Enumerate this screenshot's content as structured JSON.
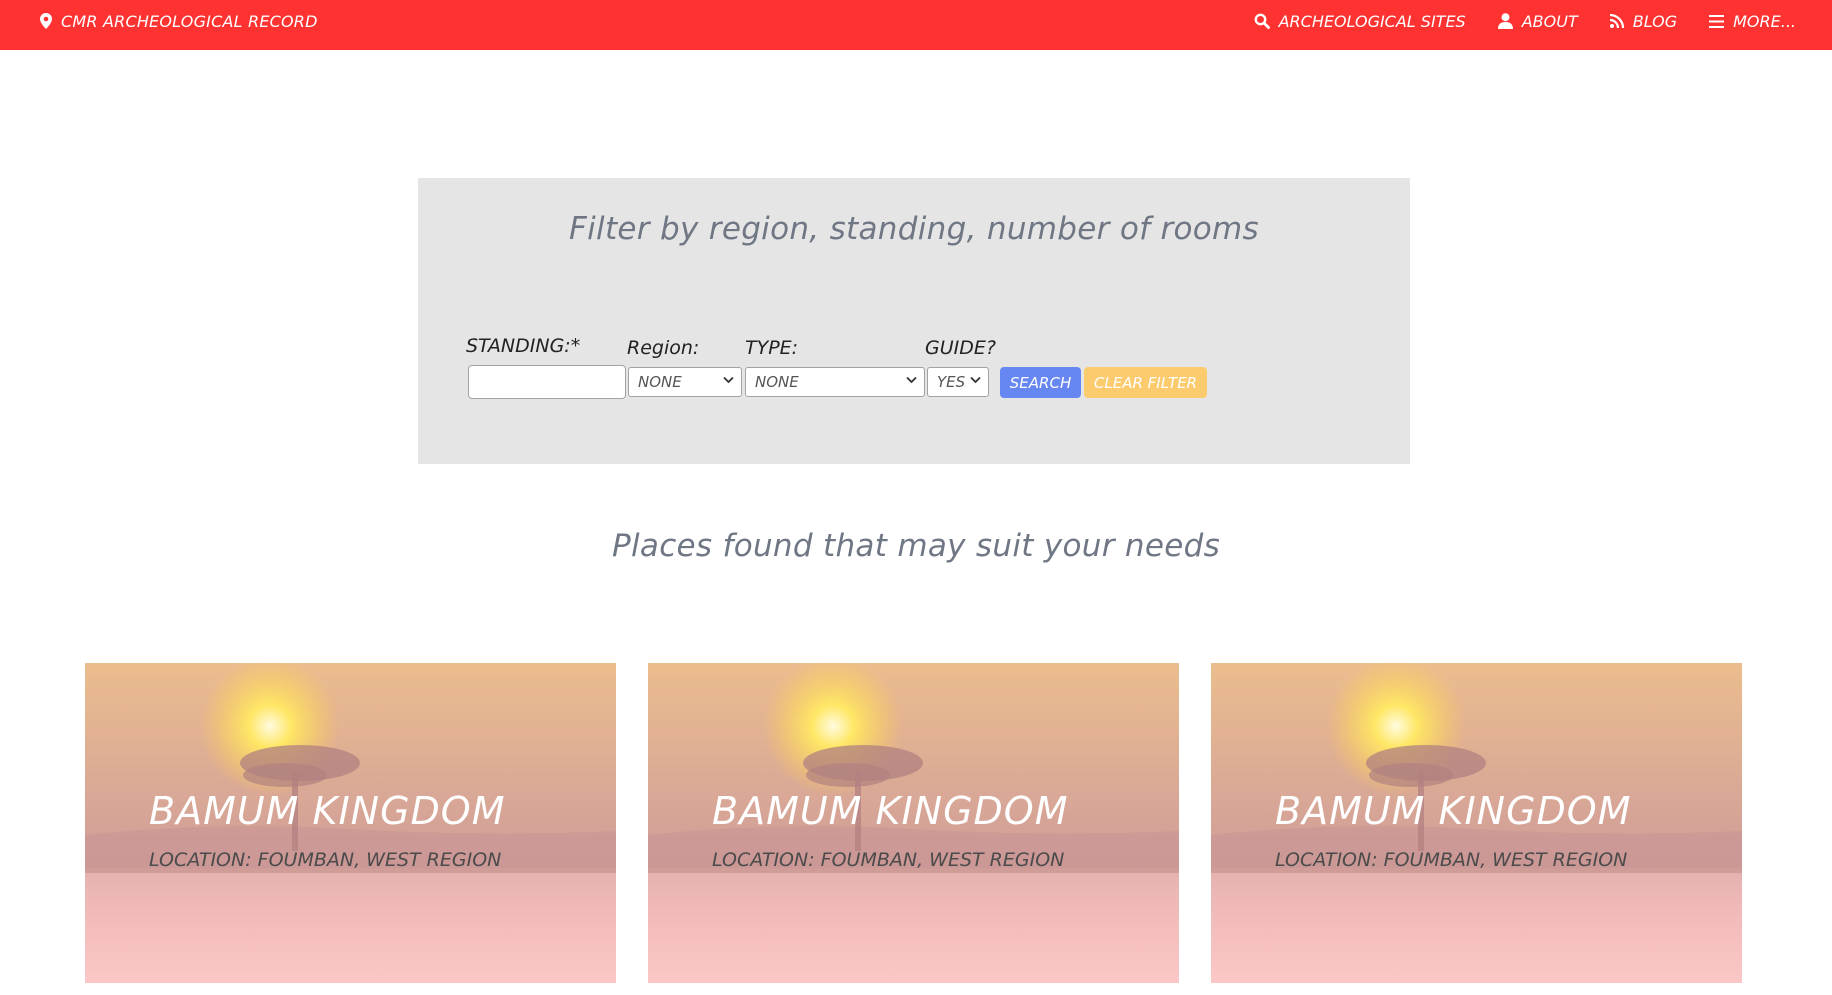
{
  "navbar": {
    "brand": "CMR ARCHEOLOGICAL RECORD",
    "brand_icon": "map-marker-icon",
    "items": [
      {
        "label": "ARCHEOLOGICAL SITES",
        "icon": "search-icon"
      },
      {
        "label": "ABOUT",
        "icon": "user-icon"
      },
      {
        "label": "BLOG",
        "icon": "rss-icon"
      },
      {
        "label": "MORE...",
        "icon": "hamburger-menu-icon"
      }
    ],
    "background_color": "#ff3232"
  },
  "filter": {
    "title": "Filter by region, standing, number of rooms",
    "standing_label": "STANDING:*",
    "standing_value": "",
    "region_label": "Region:",
    "region_value": "NONE",
    "type_label": "TYPE:",
    "type_value": "NONE",
    "guide_label": "GUIDE?",
    "guide_value": "YES",
    "search_label": "SEARCH",
    "clear_label": "CLEAR FILTER",
    "search_color": "#6686f2",
    "clear_color": "#fccb6e"
  },
  "results": {
    "heading": "Places found that may suit your needs",
    "cards": [
      {
        "title": "BAMUM KINGDOM",
        "location": "LOCATION: FOUMBAN, WEST REGION"
      },
      {
        "title": "BAMUM KINGDOM",
        "location": "LOCATION: FOUMBAN, WEST REGION"
      },
      {
        "title": "BAMUM KINGDOM",
        "location": "LOCATION: FOUMBAN, WEST REGION"
      }
    ]
  }
}
